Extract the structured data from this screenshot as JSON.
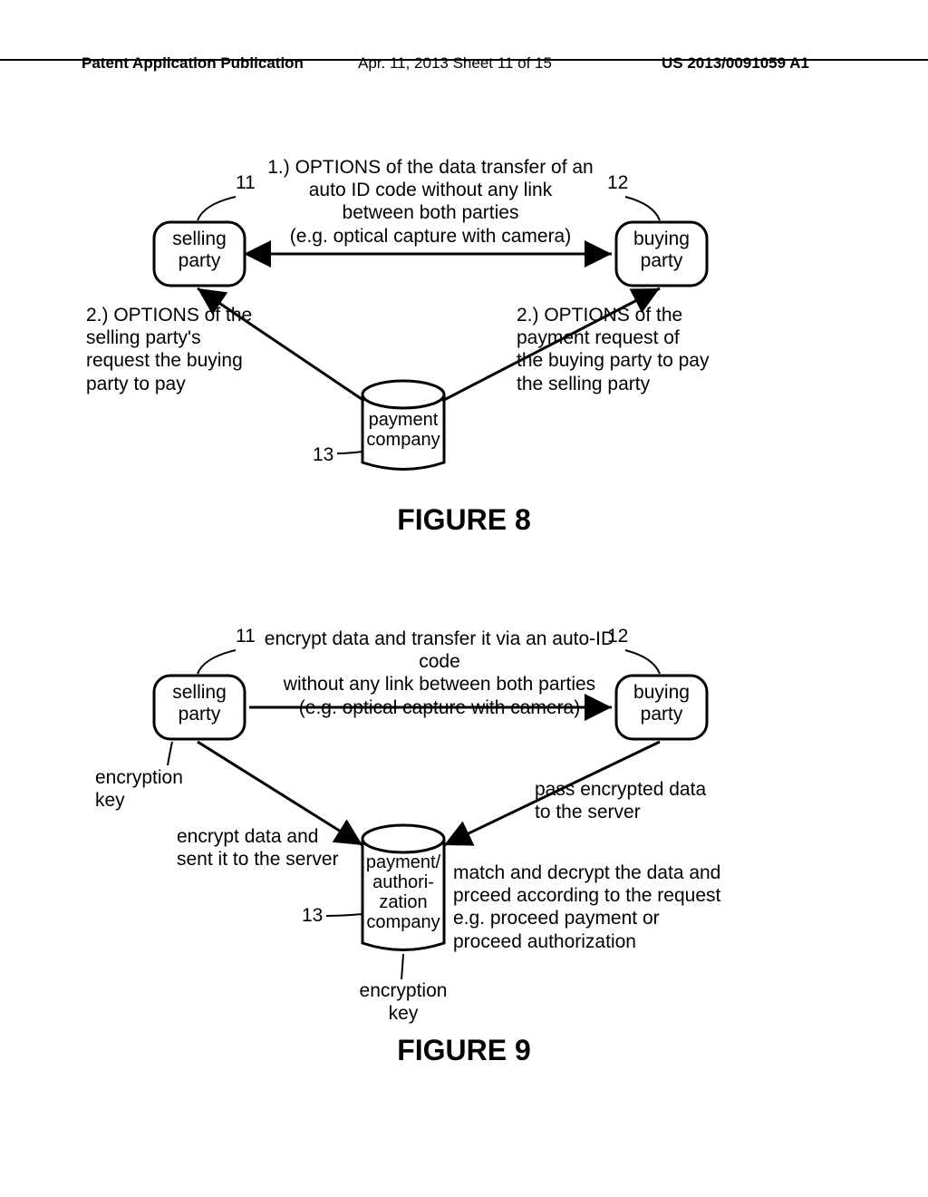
{
  "header": {
    "left": "Patent Application Publication",
    "center": "Apr. 11, 2013  Sheet 11 of 15",
    "right": "US 2013/0091059 A1"
  },
  "fig8": {
    "title": "FIGURE 8",
    "ref11": "11",
    "ref12": "12",
    "ref13": "13",
    "seller": "selling\nparty",
    "buyer": "buying\nparty",
    "cylinder": "payment\ncompany",
    "top_text": "1.) OPTIONS of the data transfer of an\nauto ID code without any link\nbetween both parties\n(e.g. optical capture with camera)",
    "left_text": "2.) OPTIONS of the\nselling party's\nrequest the buying\nparty to pay",
    "right_text": "2.) OPTIONS of the\npayment request of\nthe buying party to pay\nthe selling party"
  },
  "fig9": {
    "title": "FIGURE 9",
    "ref11": "11",
    "ref12": "12",
    "ref13": "13",
    "seller": "selling\nparty",
    "buyer": "buying\nparty",
    "cylinder": "payment/\nauthori-\nzation\ncompany",
    "top_text": "encrypt data and transfer it via an auto-ID code\nwithout any link between both parties\n(e.g. optical capture with camera)",
    "enc_key_left": "encryption\nkey",
    "enc_key_bottom": "encryption\nkey",
    "left_text": "encrypt data and\nsent it to the server",
    "right_top": "pass encrypted data\nto the server",
    "right_bottom": "match and decrypt the data and\nprceed according to the request\ne.g. proceed payment or\nproceed authorization"
  }
}
